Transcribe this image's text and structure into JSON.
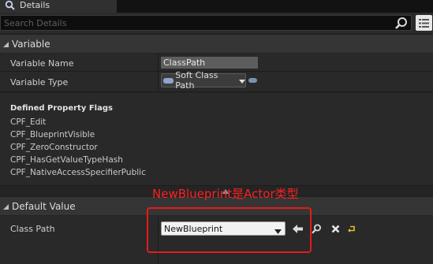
{
  "tab": {
    "title": "Details"
  },
  "search": {
    "placeholder": "Search Details"
  },
  "sections": {
    "variable": {
      "title": "Variable",
      "variable_name_label": "Variable Name",
      "variable_name_value": "ClassPath",
      "variable_type_label": "Variable Type",
      "variable_type_value": "Soft Class Path",
      "flags_title": "Defined Property Flags",
      "flags": [
        "CPF_Edit",
        "CPF_BlueprintVisible",
        "CPF_ZeroConstructor",
        "CPF_HasGetValueTypeHash",
        "CPF_NativeAccessSpecifierPublic"
      ]
    },
    "default_value": {
      "title": "Default Value",
      "class_path_label": "Class Path",
      "class_path_value": "NewBlueprint"
    }
  },
  "annotation": {
    "text": "NewBlueprint是Actor类型",
    "color": "#ff2020"
  },
  "icons": [
    "details-icon",
    "search-icon",
    "view-options-icon",
    "collapse-arrow-icon",
    "chevron-down-icon",
    "use-selected-arrow-icon",
    "browse-icon",
    "clear-icon",
    "reset-to-default-icon"
  ],
  "colors": {
    "type_pin": "#8fa4cc",
    "highlight_box": "#e41b1b"
  }
}
